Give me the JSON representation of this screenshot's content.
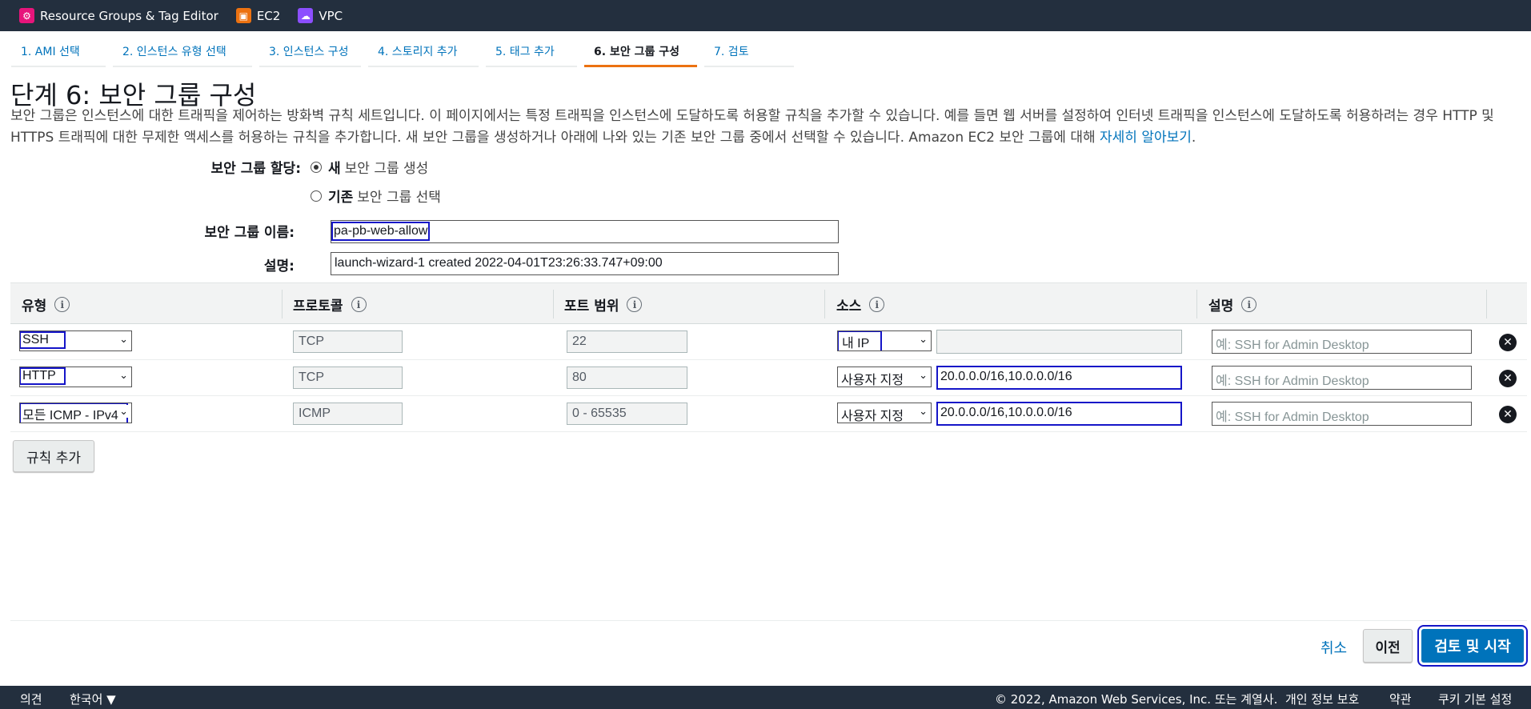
{
  "topbar": {
    "items": [
      {
        "label": "Resource Groups & Tag Editor",
        "icon": "resource-groups-icon",
        "color": "#e7157b"
      },
      {
        "label": "EC2",
        "icon": "ec2-icon",
        "color": "#ec7211"
      },
      {
        "label": "VPC",
        "icon": "vpc-icon",
        "color": "#8c4fff"
      }
    ]
  },
  "tabs": [
    "1. AMI 선택",
    "2. 인스턴스 유형 선택",
    "3. 인스턴스 구성",
    "4. 스토리지 추가",
    "5. 태그 추가",
    "6. 보안 그룹 구성",
    "7. 검토"
  ],
  "header": {
    "title": "단계 6: 보안 그룹 구성",
    "description": "보안 그룹은 인스턴스에 대한 트래픽을 제어하는 방화벽 규칙 세트입니다. 이 페이지에서는 특정 트래픽을 인스턴스에 도달하도록 허용할 규칙을 추가할 수 있습니다. 예를 들면 웹 서버를 설정하여 인터넷 트래픽을 인스턴스에 도달하도록 허용하려는 경우 HTTP 및 HTTPS 트래픽에 대한 무제한 액세스를 허용하는 규칙을 추가합니다. 새 보안 그룹을 생성하거나 아래에 나와 있는 기존 보안 그룹 중에서 선택할 수 있습니다. Amazon EC2 보안 그룹에 대해",
    "learn_more": "자세히 알아보기",
    "period": "."
  },
  "form": {
    "assign_label": "보안 그룹 할당:",
    "option_new_bold": "새",
    "option_new_rest": "보안 그룹 생성",
    "option_existing_bold": "기존",
    "option_existing_rest": "보안 그룹 선택",
    "selected_option": "new",
    "name_label": "보안 그룹 이름:",
    "name_value": "pa-pb-web-allow",
    "desc_label": "설명:",
    "desc_value": "launch-wizard-1 created 2022-04-01T23:26:33.747+09:00"
  },
  "table": {
    "headers": [
      "유형",
      "프로토콜",
      "포트 범위",
      "소스",
      "설명"
    ],
    "info_glyph": "i",
    "rows": [
      {
        "type": "SSH",
        "protocol": "TCP",
        "port": "22",
        "source_type": "내 IP",
        "source_value": "",
        "description_placeholder": "예: SSH for Admin Desktop"
      },
      {
        "type": "HTTP",
        "protocol": "TCP",
        "port": "80",
        "source_type": "사용자 지정",
        "source_value": "20.0.0.0/16,10.0.0.0/16",
        "description_placeholder": "예: SSH for Admin Desktop"
      },
      {
        "type": "모든 ICMP - IPv4",
        "protocol": "ICMP",
        "port": "0 - 65535",
        "source_type": "사용자 지정",
        "source_value": "20.0.0.0/16,10.0.0.0/16",
        "description_placeholder": "예: SSH for Admin Desktop"
      }
    ],
    "add_rule": "규칙 추가"
  },
  "actions": {
    "cancel": "취소",
    "previous": "이전",
    "review_launch": "검토 및 시작"
  },
  "footer": {
    "feedback": "의견",
    "language": "한국어 ▼",
    "copyright": "© 2022, Amazon Web Services, Inc. 또는 계열사.",
    "privacy": "개인 정보 보호",
    "terms": "약관",
    "cookies": "쿠키 기본 설정"
  },
  "colors": {
    "topbar": "#232f3e",
    "link": "#0073bb",
    "active_tab": "#ec7211",
    "highlight_box": "#1515c8"
  }
}
